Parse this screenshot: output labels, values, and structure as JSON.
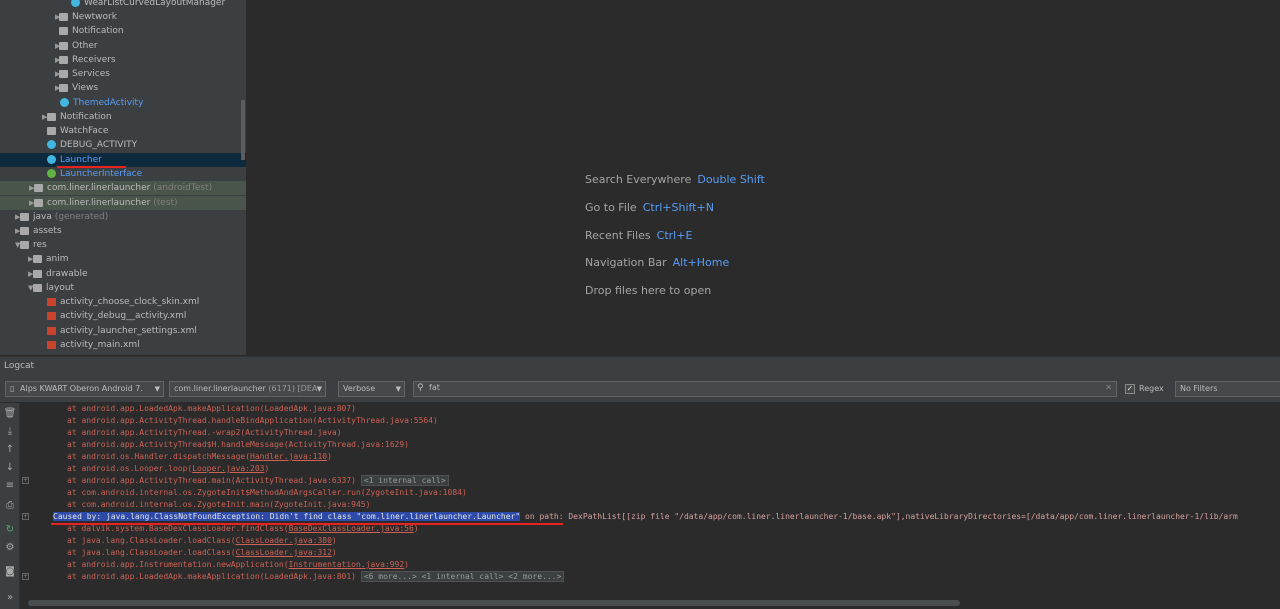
{
  "project_tree": {
    "rows": [
      {
        "label": "WearListCurvedLayoutManager",
        "icon": "class-icon",
        "color": "#bbbbbb"
      },
      {
        "label": "Newtwork",
        "icon": "folder-icon",
        "color": "#bbbbbb"
      },
      {
        "label": "Notification",
        "icon": "folder-icon",
        "color": "#bbbbbb"
      },
      {
        "label": "Other",
        "icon": "folder-icon",
        "color": "#bbbbbb"
      },
      {
        "label": "Receivers",
        "icon": "folder-icon",
        "color": "#bbbbbb"
      },
      {
        "label": "Services",
        "icon": "folder-icon",
        "color": "#bbbbbb"
      },
      {
        "label": "Views",
        "icon": "folder-icon",
        "color": "#bbbbbb"
      },
      {
        "label": "ThemedActivity",
        "icon": "class-icon",
        "color": "#589df6"
      },
      {
        "label": "Notification",
        "icon": "folder-icon",
        "color": "#bbbbbb"
      },
      {
        "label": "WatchFace",
        "icon": "folder-icon",
        "color": "#bbbbbb"
      },
      {
        "label": "DEBUG_ACTIVITY",
        "icon": "class-icon",
        "color": "#bbbbbb"
      },
      {
        "label": "Launcher",
        "icon": "class-icon",
        "color": "#589df6"
      },
      {
        "label": "LauncherInterface",
        "icon": "interface-icon",
        "color": "#589df6"
      },
      {
        "label": "com.liner.linerlauncher",
        "suffix": "(androidTest)",
        "icon": "folder-icon",
        "color": "#bbbbbb"
      },
      {
        "label": "com.liner.linerlauncher",
        "suffix": "(test)",
        "icon": "folder-icon",
        "color": "#bbbbbb"
      },
      {
        "label": "java",
        "suffix": "(generated)",
        "icon": "folder-icon",
        "color": "#bbbbbb"
      },
      {
        "label": "assets",
        "icon": "folder-icon",
        "color": "#bbbbbb"
      },
      {
        "label": "res",
        "icon": "folder-icon",
        "color": "#bbbbbb"
      },
      {
        "label": "anim",
        "icon": "folder-icon",
        "color": "#bbbbbb"
      },
      {
        "label": "drawable",
        "icon": "folder-icon",
        "color": "#bbbbbb"
      },
      {
        "label": "layout",
        "icon": "folder-icon",
        "color": "#bbbbbb"
      },
      {
        "label": "activity_choose_clock_skin.xml",
        "icon": "xml-file-icon",
        "color": "#bbbbbb"
      },
      {
        "label": "activity_debug__activity.xml",
        "icon": "xml-file-icon",
        "color": "#bbbbbb"
      },
      {
        "label": "activity_launcher_settings.xml",
        "icon": "xml-file-icon",
        "color": "#bbbbbb"
      },
      {
        "label": "activity_main.xml",
        "icon": "xml-file-icon",
        "color": "#bbbbbb"
      }
    ]
  },
  "editor_hints": [
    {
      "text": "Search Everywhere",
      "key": "Double Shift"
    },
    {
      "text": "Go to File",
      "key": "Ctrl+Shift+N"
    },
    {
      "text": "Recent Files",
      "key": "Ctrl+E"
    },
    {
      "text": "Navigation Bar",
      "key": "Alt+Home"
    },
    {
      "text": "Drop files here to open",
      "key": ""
    }
  ],
  "logcat": {
    "title": "Logcat",
    "device": "Alps KWART Oberon Android 7.",
    "process": "com.liner.linerlauncher",
    "process_pid": "(6171) [DEA",
    "level": "Verbose",
    "search_value": "fat",
    "regex_label": "Regex",
    "filter": "No Filters"
  },
  "log_lines": [
    {
      "pre": "at android.app.LoadedApk.makeApplication(LoadedApk.java:807)",
      "link": "",
      "post": ""
    },
    {
      "pre": "at android.app.ActivityThread.handleBindApplication(ActivityThread.java:5564)",
      "link": "",
      "post": ""
    },
    {
      "pre": "at android.app.ActivityThread.-wrap2(ActivityThread.java)",
      "link": "",
      "post": ""
    },
    {
      "pre": "at android.app.ActivityThread$H.handleMessage(ActivityThread.java:1629)",
      "link": "",
      "post": ""
    },
    {
      "pre": "at android.os.Handler.dispatchMessage(",
      "link": "Handler.java:110",
      "post": ")"
    },
    {
      "pre": "at android.os.Looper.loop(",
      "link": "Looper.java:203",
      "post": ")"
    },
    {
      "pre": "at android.app.ActivityThread.main(ActivityThread.java:6337) ",
      "link": "",
      "post": "",
      "fold": "<1 internal call>"
    },
    {
      "pre": "at com.android.internal.os.ZygoteInit$MethodAndArgsCaller.run(ZygoteInit.java:1084)",
      "link": "",
      "post": ""
    },
    {
      "pre": "at com.android.internal.os.ZygoteInit.main(ZygoteInit.java:945)",
      "link": "",
      "post": ""
    },
    {
      "pre": "at dalvik.system.BaseDexClassLoader.findClass(",
      "link": "BaseDexClassLoader.java:56",
      "post": ")"
    },
    {
      "pre": "at java.lang.ClassLoader.loadClass(",
      "link": "ClassLoader.java:380",
      "post": ")"
    },
    {
      "pre": "at java.lang.ClassLoader.loadClass(",
      "link": "ClassLoader.java:312",
      "post": ")"
    },
    {
      "pre": "at android.app.Instrumentation.newApplication(",
      "link": "Instrumentation.java:992",
      "post": ")"
    },
    {
      "pre": "at android.app.LoadedApk.makeApplication(LoadedApk.java:801) ",
      "link": "",
      "post": "",
      "fold": "<6 more...> <1 internal call> <2 more...>"
    }
  ],
  "caused_by": {
    "highlight": "Caused by: java.lang.ClassNotFoundException: Didn't find class \"com.liner.linerlauncher.Launcher\"",
    "rest": " on path: DexPathList[[zip file \"/data/app/com.liner.linerlauncher-1/base.apk\"],nativeLibraryDirectories=[/data/app/com.liner.linerlauncher-1/lib/arm"
  },
  "colors": {
    "accent": "#589df6",
    "error": "#cc6155",
    "selection": "#0d293e",
    "annotation": "#e8231f"
  }
}
